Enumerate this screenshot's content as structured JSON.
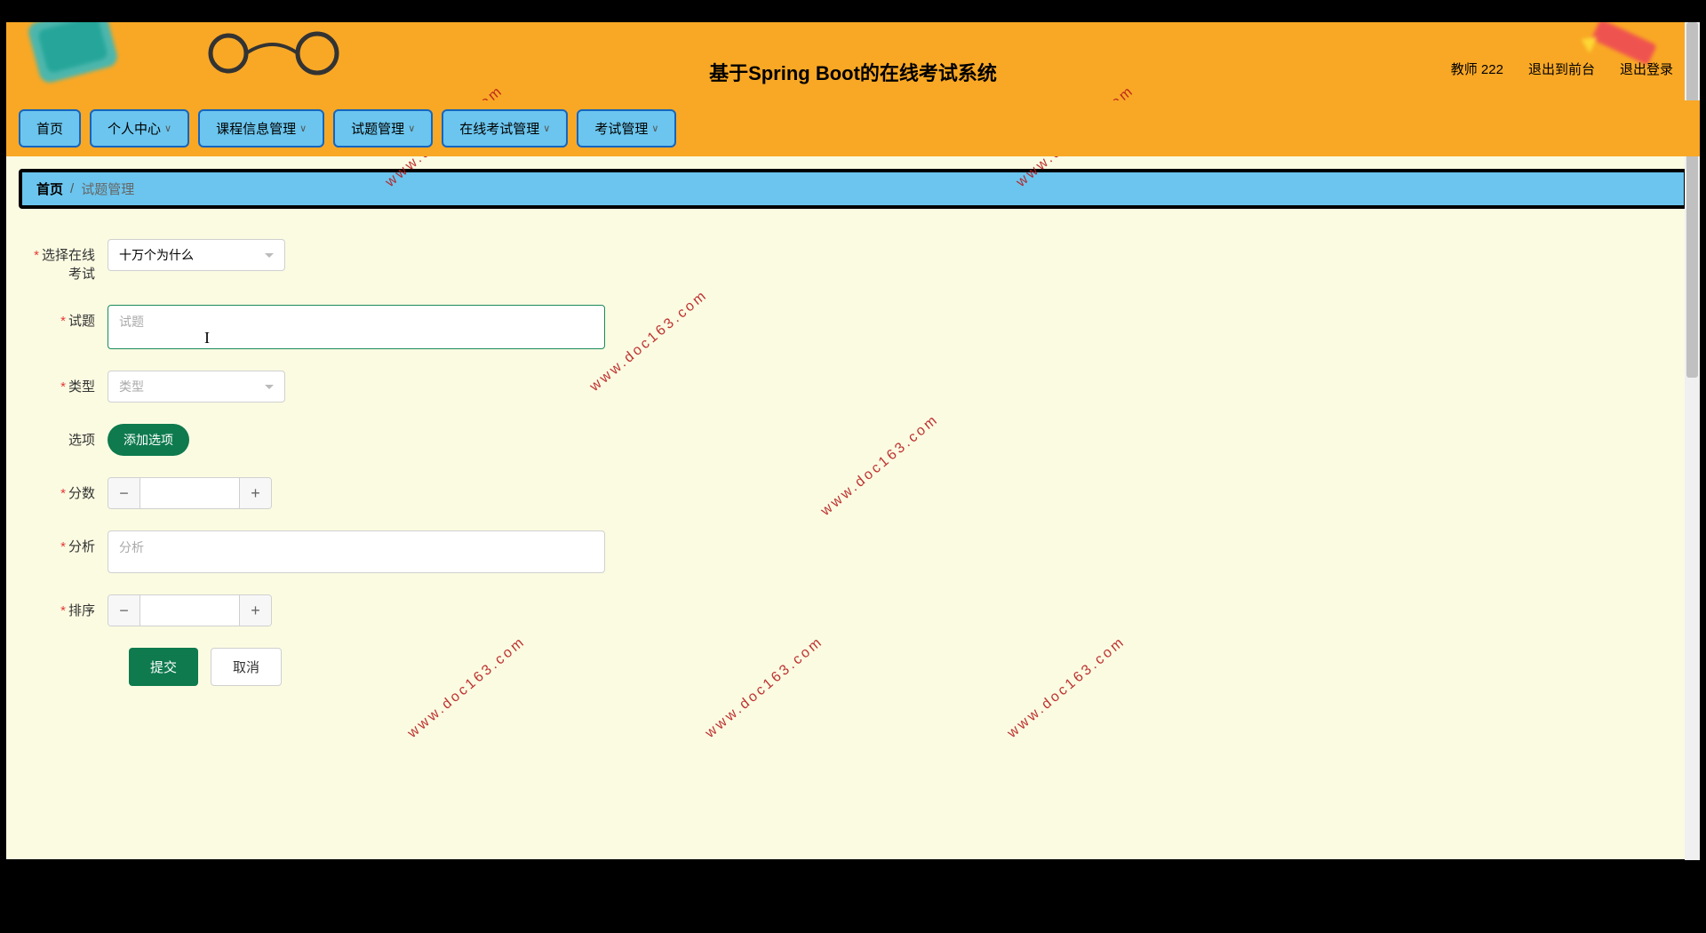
{
  "header": {
    "title": "基于Spring Boot的在线考试系统",
    "user_role": "教师 222",
    "back_to_front": "退出到前台",
    "logout": "退出登录"
  },
  "nav": {
    "home": "首页",
    "personal": "个人中心",
    "course": "课程信息管理",
    "question": "试题管理",
    "exam_online": "在线考试管理",
    "exam": "考试管理"
  },
  "breadcrumb": {
    "home": "首页",
    "current": "试题管理"
  },
  "form": {
    "exam_label": "选择在线考试",
    "exam_value": "十万个为什么",
    "question_label": "试题",
    "question_placeholder": "试题",
    "type_label": "类型",
    "type_placeholder": "类型",
    "option_label": "选项",
    "add_option_btn": "添加选项",
    "score_label": "分数",
    "analysis_label": "分析",
    "analysis_placeholder": "分析",
    "sort_label": "排序",
    "submit": "提交",
    "cancel": "取消"
  },
  "watermark": "www.doc163.com"
}
